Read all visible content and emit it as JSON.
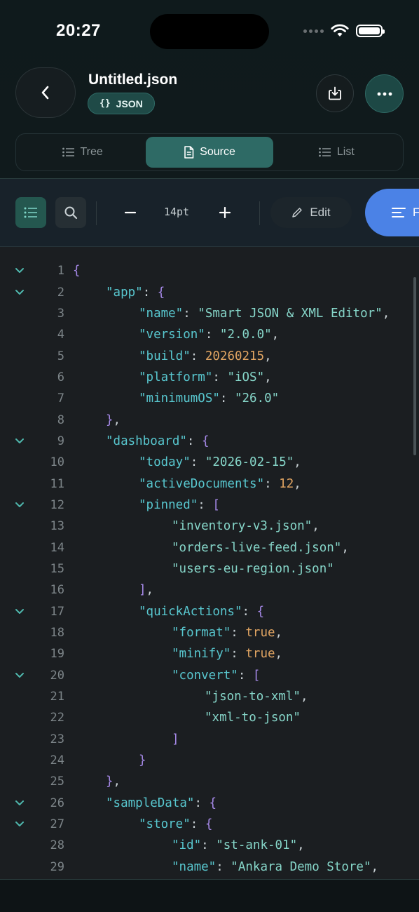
{
  "status": {
    "time": "20:27"
  },
  "header": {
    "title": "Untitled.json",
    "badge_icon": "{}",
    "badge_label": "JSON"
  },
  "tabs": [
    {
      "label": "Tree",
      "active": false
    },
    {
      "label": "Source",
      "active": true
    },
    {
      "label": "List",
      "active": false
    }
  ],
  "toolbar": {
    "font_size": "14pt",
    "edit_label": "Edit",
    "format_label": "Format"
  },
  "colors": {
    "accent": "#2e6a65",
    "format_button": "#4b82e6",
    "key": "#58c7cf",
    "string": "#86d6c9",
    "number": "#e0a462",
    "bracket": "#a689e8"
  },
  "lines": [
    {
      "num": "1",
      "fold": true,
      "indent": 0,
      "tokens": [
        [
          "p",
          "{"
        ]
      ]
    },
    {
      "num": "2",
      "fold": true,
      "indent": 1,
      "tokens": [
        [
          "k",
          "\"app\""
        ],
        [
          "c",
          ": "
        ],
        [
          "p",
          "{"
        ]
      ]
    },
    {
      "num": "3",
      "fold": false,
      "indent": 2,
      "tokens": [
        [
          "k",
          "\"name\""
        ],
        [
          "c",
          ": "
        ],
        [
          "s",
          "\"Smart JSON & XML Editor\""
        ],
        [
          "c",
          ","
        ]
      ]
    },
    {
      "num": "4",
      "fold": false,
      "indent": 2,
      "tokens": [
        [
          "k",
          "\"version\""
        ],
        [
          "c",
          ": "
        ],
        [
          "s",
          "\"2.0.0\""
        ],
        [
          "c",
          ","
        ]
      ]
    },
    {
      "num": "5",
      "fold": false,
      "indent": 2,
      "tokens": [
        [
          "k",
          "\"build\""
        ],
        [
          "c",
          ": "
        ],
        [
          "n",
          "20260215"
        ],
        [
          "c",
          ","
        ]
      ]
    },
    {
      "num": "6",
      "fold": false,
      "indent": 2,
      "tokens": [
        [
          "k",
          "\"platform\""
        ],
        [
          "c",
          ": "
        ],
        [
          "s",
          "\"iOS\""
        ],
        [
          "c",
          ","
        ]
      ]
    },
    {
      "num": "7",
      "fold": false,
      "indent": 2,
      "tokens": [
        [
          "k",
          "\"minimumOS\""
        ],
        [
          "c",
          ": "
        ],
        [
          "s",
          "\"26.0\""
        ]
      ]
    },
    {
      "num": "8",
      "fold": false,
      "indent": 1,
      "tokens": [
        [
          "p",
          "}"
        ],
        [
          "c",
          ","
        ]
      ]
    },
    {
      "num": "9",
      "fold": true,
      "indent": 1,
      "tokens": [
        [
          "k",
          "\"dashboard\""
        ],
        [
          "c",
          ": "
        ],
        [
          "p",
          "{"
        ]
      ]
    },
    {
      "num": "10",
      "fold": false,
      "indent": 2,
      "tokens": [
        [
          "k",
          "\"today\""
        ],
        [
          "c",
          ": "
        ],
        [
          "s",
          "\"2026-02-15\""
        ],
        [
          "c",
          ","
        ]
      ]
    },
    {
      "num": "11",
      "fold": false,
      "indent": 2,
      "tokens": [
        [
          "k",
          "\"activeDocuments\""
        ],
        [
          "c",
          ": "
        ],
        [
          "n",
          "12"
        ],
        [
          "c",
          ","
        ]
      ]
    },
    {
      "num": "12",
      "fold": true,
      "indent": 2,
      "tokens": [
        [
          "k",
          "\"pinned\""
        ],
        [
          "c",
          ": "
        ],
        [
          "p",
          "["
        ]
      ]
    },
    {
      "num": "13",
      "fold": false,
      "indent": 3,
      "tokens": [
        [
          "s",
          "\"inventory-v3.json\""
        ],
        [
          "c",
          ","
        ]
      ]
    },
    {
      "num": "14",
      "fold": false,
      "indent": 3,
      "tokens": [
        [
          "s",
          "\"orders-live-feed.json\""
        ],
        [
          "c",
          ","
        ]
      ]
    },
    {
      "num": "15",
      "fold": false,
      "indent": 3,
      "tokens": [
        [
          "s",
          "\"users-eu-region.json\""
        ]
      ]
    },
    {
      "num": "16",
      "fold": false,
      "indent": 2,
      "tokens": [
        [
          "p",
          "]"
        ],
        [
          "c",
          ","
        ]
      ]
    },
    {
      "num": "17",
      "fold": true,
      "indent": 2,
      "tokens": [
        [
          "k",
          "\"quickActions\""
        ],
        [
          "c",
          ": "
        ],
        [
          "p",
          "{"
        ]
      ]
    },
    {
      "num": "18",
      "fold": false,
      "indent": 3,
      "tokens": [
        [
          "k",
          "\"format\""
        ],
        [
          "c",
          ": "
        ],
        [
          "b",
          "true"
        ],
        [
          "c",
          ","
        ]
      ]
    },
    {
      "num": "19",
      "fold": false,
      "indent": 3,
      "tokens": [
        [
          "k",
          "\"minify\""
        ],
        [
          "c",
          ": "
        ],
        [
          "b",
          "true"
        ],
        [
          "c",
          ","
        ]
      ]
    },
    {
      "num": "20",
      "fold": true,
      "indent": 3,
      "tokens": [
        [
          "k",
          "\"convert\""
        ],
        [
          "c",
          ": "
        ],
        [
          "p",
          "["
        ]
      ]
    },
    {
      "num": "21",
      "fold": false,
      "indent": 4,
      "tokens": [
        [
          "s",
          "\"json-to-xml\""
        ],
        [
          "c",
          ","
        ]
      ]
    },
    {
      "num": "22",
      "fold": false,
      "indent": 4,
      "tokens": [
        [
          "s",
          "\"xml-to-json\""
        ]
      ]
    },
    {
      "num": "23",
      "fold": false,
      "indent": 3,
      "tokens": [
        [
          "p",
          "]"
        ]
      ]
    },
    {
      "num": "24",
      "fold": false,
      "indent": 2,
      "tokens": [
        [
          "p",
          "}"
        ]
      ]
    },
    {
      "num": "25",
      "fold": false,
      "indent": 1,
      "tokens": [
        [
          "p",
          "}"
        ],
        [
          "c",
          ","
        ]
      ]
    },
    {
      "num": "26",
      "fold": true,
      "indent": 1,
      "tokens": [
        [
          "k",
          "\"sampleData\""
        ],
        [
          "c",
          ": "
        ],
        [
          "p",
          "{"
        ]
      ]
    },
    {
      "num": "27",
      "fold": true,
      "indent": 2,
      "tokens": [
        [
          "k",
          "\"store\""
        ],
        [
          "c",
          ": "
        ],
        [
          "p",
          "{"
        ]
      ]
    },
    {
      "num": "28",
      "fold": false,
      "indent": 3,
      "tokens": [
        [
          "k",
          "\"id\""
        ],
        [
          "c",
          ": "
        ],
        [
          "s",
          "\"st-ank-01\""
        ],
        [
          "c",
          ","
        ]
      ]
    },
    {
      "num": "29",
      "fold": false,
      "indent": 3,
      "tokens": [
        [
          "k",
          "\"name\""
        ],
        [
          "c",
          ": "
        ],
        [
          "s",
          "\"Ankara Demo Store\""
        ],
        [
          "c",
          ","
        ]
      ]
    }
  ]
}
